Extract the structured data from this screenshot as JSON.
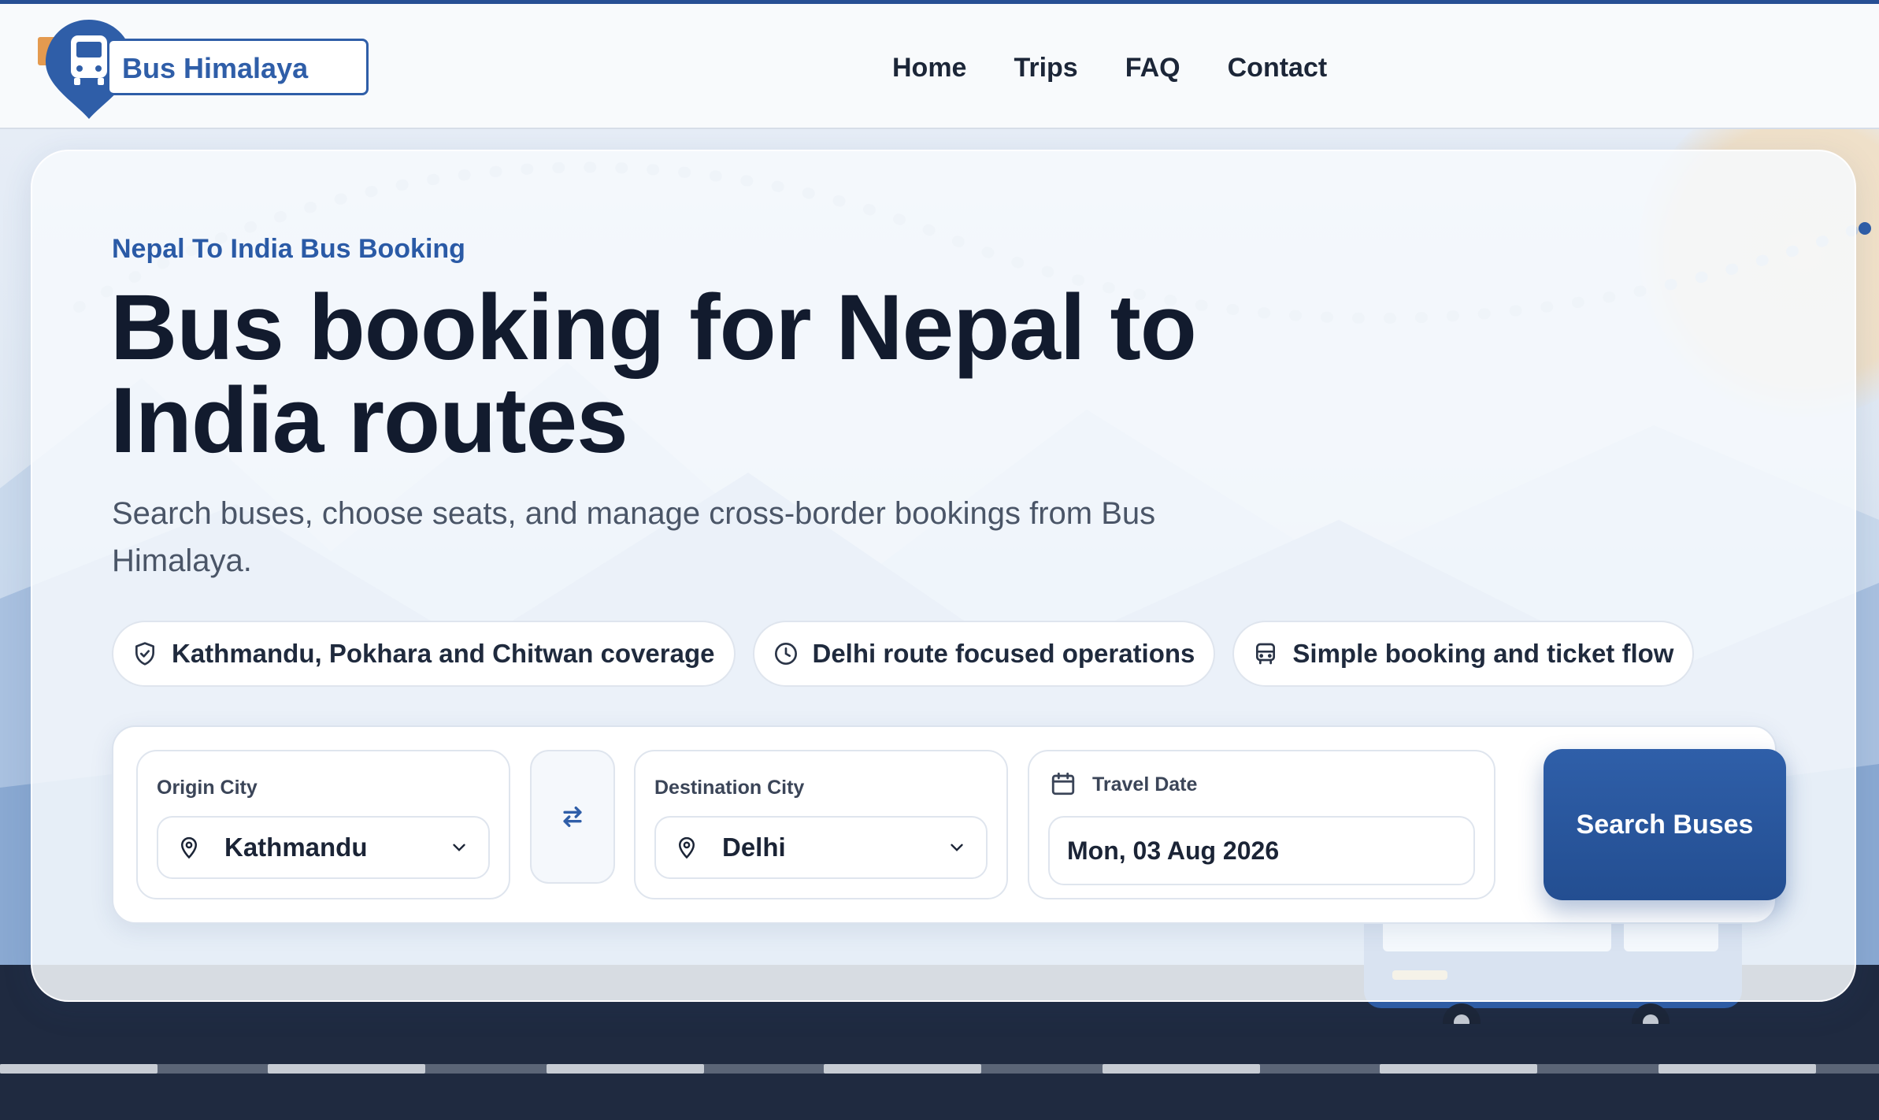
{
  "brand": {
    "name": "Bus Himalaya",
    "color": "#2f5ea8",
    "accent": "#e49a4f"
  },
  "nav": {
    "items": [
      "Home",
      "Trips",
      "FAQ",
      "Contact"
    ]
  },
  "hero": {
    "eyebrow": "Nepal To India Bus Booking",
    "title": "Bus booking for Nepal to India routes",
    "subtitle": "Search buses, choose seats, and manage cross-border bookings from Bus Himalaya."
  },
  "features": [
    {
      "icon": "shield-icon",
      "label": "Kathmandu, Pokhara and Chitwan coverage"
    },
    {
      "icon": "clock-icon",
      "label": "Delhi route focused operations"
    },
    {
      "icon": "bus-icon",
      "label": "Simple booking and ticket flow"
    }
  ],
  "search": {
    "origin": {
      "label": "Origin City",
      "value": "Kathmandu"
    },
    "swap_icon": "swap-arrows-icon",
    "destination": {
      "label": "Destination City",
      "value": "Delhi"
    },
    "date": {
      "label": "Travel Date",
      "value": "Mon, 03 Aug 2026"
    },
    "submit_label": "Search Buses",
    "button_color": "#234e91"
  }
}
